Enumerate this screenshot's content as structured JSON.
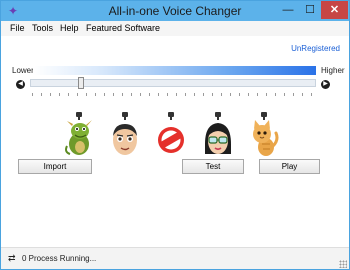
{
  "window": {
    "title": "All-in-one Voice Changer"
  },
  "menu": [
    "File",
    "Tools",
    "Help",
    "Featured Software"
  ],
  "registration": "UnRegistered",
  "pitch": {
    "lower_label": "Lower",
    "higher_label": "Higher",
    "value": 0.17
  },
  "voices": [
    "dragon-voice-icon",
    "man-voice-icon",
    "no-voice-icon",
    "woman-voice-icon",
    "cat-voice-icon"
  ],
  "buttons": {
    "import": "Import",
    "test": "Test",
    "play": "Play"
  },
  "status": {
    "text": "0 Process Running..."
  },
  "colors": {
    "title_bar": "#5cb2ea",
    "link": "#1a5fd6",
    "close_button": "#c74646"
  }
}
